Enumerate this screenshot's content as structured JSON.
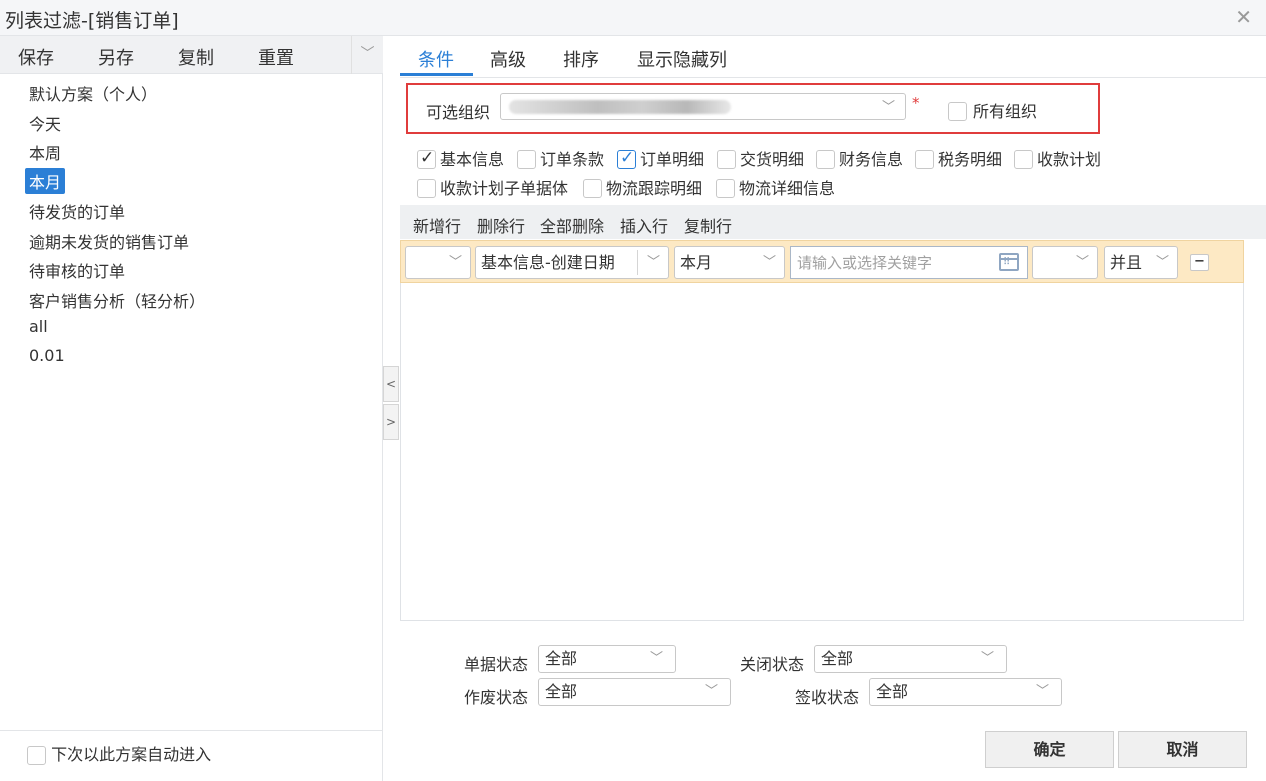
{
  "window": {
    "title": "列表过滤-[销售订单]"
  },
  "left_toolbar": {
    "buttons": [
      "保存",
      "另存",
      "复制",
      "重置"
    ]
  },
  "schemes": [
    "默认方案（个人）",
    "今天",
    "本周",
    "本月",
    "待发货的订单",
    "逾期未发货的销售订单",
    "待审核的订单",
    "客户销售分析（轻分析）",
    "all",
    "0.01"
  ],
  "selected_scheme": "本月",
  "left_footer": {
    "auto_enter_label": "下次以此方案自动进入",
    "auto_enter_checked": false
  },
  "tabs": [
    "条件",
    "高级",
    "排序",
    "显示隐藏列"
  ],
  "active_tab": "条件",
  "org": {
    "label": "可选组织",
    "required_mark": "*",
    "all_org_label": "所有组织",
    "all_org_checked": false
  },
  "field_groups": [
    {
      "label": "基本信息",
      "checked": true
    },
    {
      "label": "订单条款",
      "checked": false
    },
    {
      "label": "订单明细",
      "checked": true
    },
    {
      "label": "交货明细",
      "checked": false
    },
    {
      "label": "财务信息",
      "checked": false
    },
    {
      "label": "税务明细",
      "checked": false
    },
    {
      "label": "收款计划",
      "checked": false
    },
    {
      "label": "收款计划子单据体",
      "checked": false
    },
    {
      "label": "物流跟踪明细",
      "checked": false
    },
    {
      "label": "物流详细信息",
      "checked": false
    }
  ],
  "grid_toolbar": [
    "新增行",
    "删除行",
    "全部删除",
    "插入行",
    "复制行"
  ],
  "condition_row": {
    "left_paren": "",
    "field": "基本信息-创建日期",
    "operator": "本月",
    "keyword_placeholder": "请输入或选择关键字",
    "right_paren": "",
    "logic": "并且"
  },
  "statuses": {
    "doc_status_label": "单据状态",
    "doc_status_value": "全部",
    "close_status_label": "关闭状态",
    "close_status_value": "全部",
    "void_status_label": "作废状态",
    "void_status_value": "全部",
    "sign_status_label": "签收状态",
    "sign_status_value": "全部"
  },
  "buttons": {
    "ok": "确定",
    "cancel": "取消"
  },
  "colors": {
    "accent": "#2b7fd6",
    "highlight_box": "#e03c3c",
    "condition_row_bg": "#fde9c4"
  }
}
